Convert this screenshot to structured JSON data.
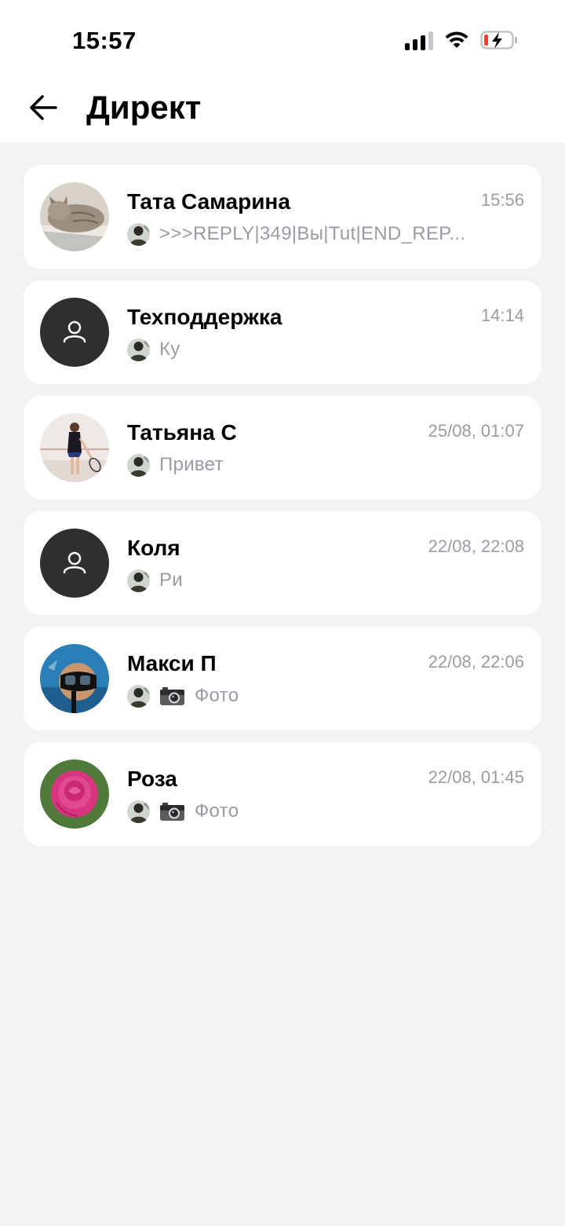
{
  "status_bar": {
    "time": "15:57"
  },
  "header": {
    "title": "Директ"
  },
  "colors": {
    "background": "#f2f3f5",
    "card": "#ffffff",
    "muted_text": "#9a9ca3",
    "placeholder_avatar": "#2f2f31",
    "battery_low": "#ff3b30"
  },
  "chats": [
    {
      "name": "Тата Самарина",
      "time": "15:56",
      "preview": ">>>REPLY|349|Вы|Tut|END_REP...",
      "avatar": "cat-photo",
      "has_photo_icon": false
    },
    {
      "name": "Техподдержка",
      "time": "14:14",
      "preview": "Ку",
      "avatar": "user-placeholder-icon",
      "has_photo_icon": false
    },
    {
      "name": "Татьяна С",
      "time": "25/08, 01:07",
      "preview": "Привет",
      "avatar": "tennis-photo",
      "has_photo_icon": false
    },
    {
      "name": "Коля",
      "time": "22/08, 22:08",
      "preview": "Ри",
      "avatar": "user-placeholder-icon",
      "has_photo_icon": false
    },
    {
      "name": "Макси П",
      "time": "22/08, 22:06",
      "preview": "Фото",
      "avatar": "diver-photo",
      "has_photo_icon": true
    },
    {
      "name": "Роза",
      "time": "22/08, 01:45",
      "preview": "Фото",
      "avatar": "rose-photo",
      "has_photo_icon": true
    }
  ]
}
